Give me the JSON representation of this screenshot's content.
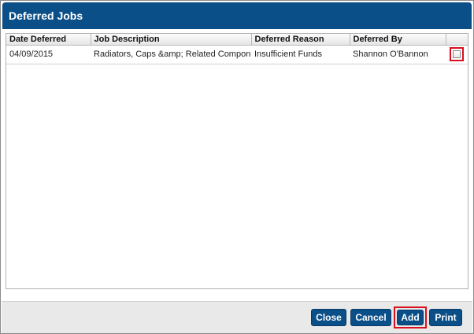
{
  "dialog": {
    "title": "Deferred Jobs"
  },
  "grid": {
    "columns": [
      "Date Deferred",
      "Job Description",
      "Deferred Reason",
      "Deferred By",
      ""
    ],
    "rows": [
      {
        "date": "04/09/2015",
        "description": "Radiators, Caps &amp; Related Components",
        "reason": "Insufficient Funds",
        "by": "Shannon O'Bannon",
        "checked": false
      }
    ]
  },
  "footer": {
    "close_label": "Close",
    "cancel_label": "Cancel",
    "add_label": "Add",
    "print_label": "Print"
  },
  "colors": {
    "primary": "#0b4f88",
    "highlight": "#d9101e"
  }
}
